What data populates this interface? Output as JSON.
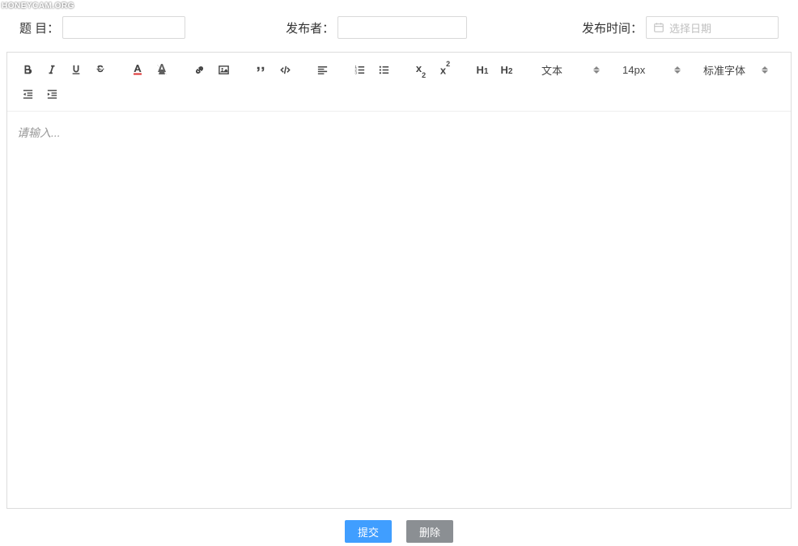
{
  "watermark": "HONEYCAM.ORG",
  "form": {
    "title_label": "题 目：",
    "title_value": "",
    "publisher_label": "发布者：",
    "publisher_value": "",
    "publish_time_label": "发布时间：",
    "date_placeholder": "选择日期"
  },
  "toolbar": {
    "select_text": "文本",
    "select_fontsize": "14px",
    "select_fontfamily": "标准字体"
  },
  "editor": {
    "placeholder": "请输入..."
  },
  "buttons": {
    "submit": "提交",
    "delete": "删除"
  }
}
